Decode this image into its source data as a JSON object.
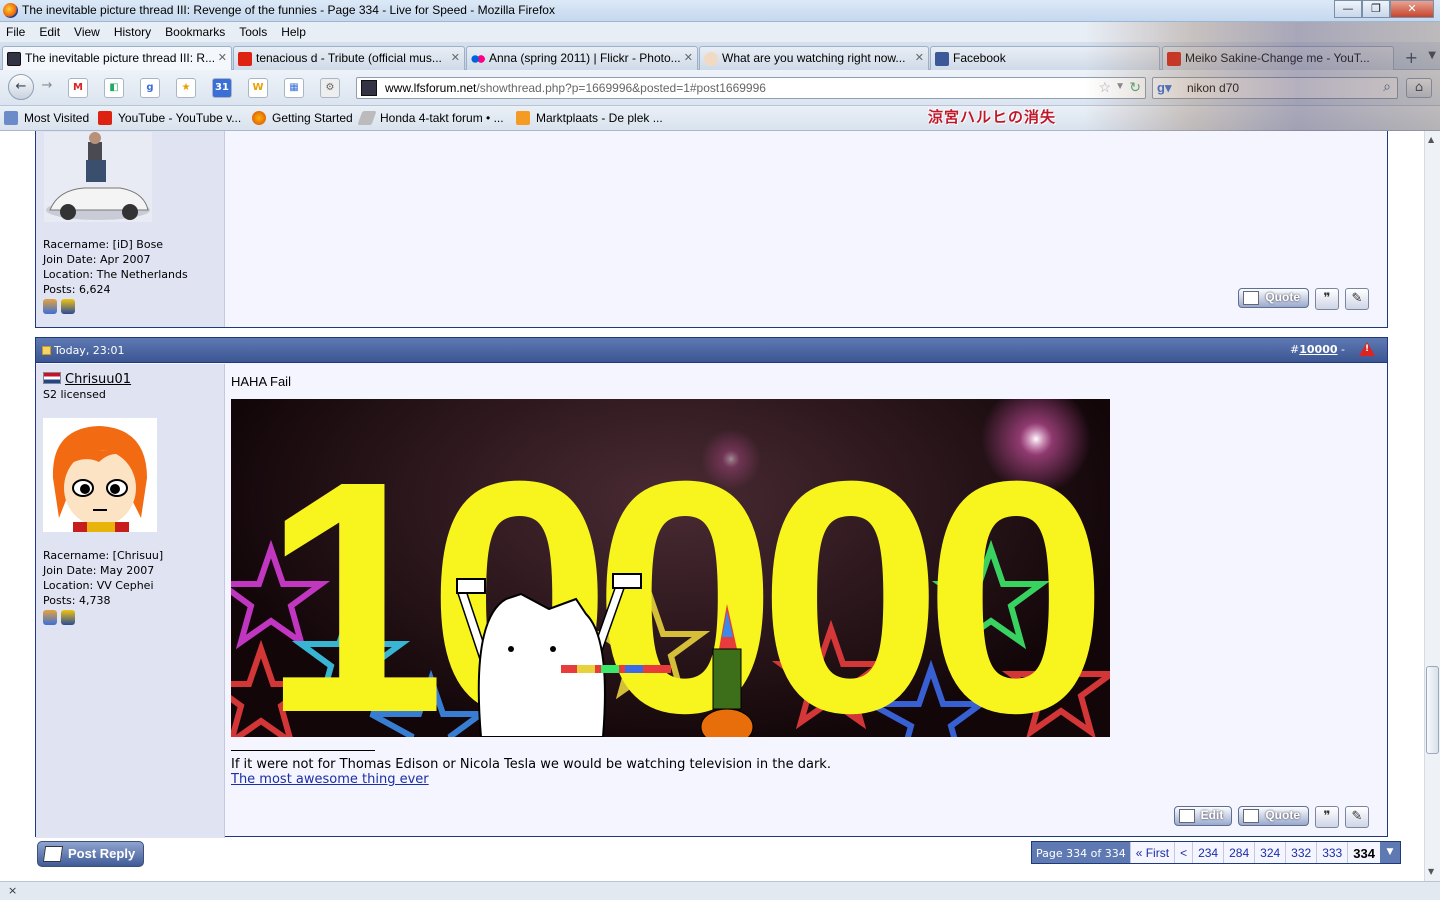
{
  "window": {
    "title": "The inevitable picture thread III: Revenge of the funnies - Page 334 - Live for Speed - Mozilla Firefox",
    "minimize": "—",
    "maximize": "❐",
    "close": "✕"
  },
  "menu": [
    "File",
    "Edit",
    "View",
    "History",
    "Bookmarks",
    "Tools",
    "Help"
  ],
  "tabs": [
    {
      "label": "The inevitable picture thread III: R...",
      "active": true
    },
    {
      "label": "tenacious d - Tribute (official mus...",
      "active": false
    },
    {
      "label": "Anna (spring 2011) | Flickr - Photo...",
      "active": false
    },
    {
      "label": "What are you watching right now...",
      "active": false
    },
    {
      "label": "Facebook",
      "active": false
    },
    {
      "label": "Meiko Sakine-Change me - YouT...",
      "active": false
    }
  ],
  "nav": {
    "url_domain": "www.lfsforum.net",
    "url_rest": "/showthread.php?p=1669996&posted=1#post1669996",
    "search_value": "nikon d70"
  },
  "bookmarks": [
    "Most Visited",
    "YouTube - YouTube v...",
    "Getting Started",
    "Honda 4-takt forum • ...",
    "Marktplaats - De plek ..."
  ],
  "persona_text": "涼宮ハルヒの消失",
  "post1": {
    "racername": "Racername: [iD] Bose",
    "join_date": "Join Date: Apr 2007",
    "location": "Location: The Netherlands",
    "posts": "Posts: 6,624",
    "quote_label": "Quote"
  },
  "post2": {
    "date": "Today, 23:01",
    "number_prefix": "#",
    "number": "10000",
    "number_suffix": "-",
    "username": "Chrisuu01",
    "user_title": "S2 licensed",
    "racername": "Racername: [Chrisuu]",
    "join_date": "Join Date: May 2007",
    "location": "Location: VV Cephei",
    "posts": "Posts: 4,738",
    "message": "HAHA Fail",
    "image_text": "10000",
    "signature": "If it were not for Thomas Edison or Nicola Tesla we would be watching television in the dark.",
    "signature_link": "The most awesome thing ever",
    "edit_label": "Edit",
    "quote_label": "Quote"
  },
  "post_reply": "Post Reply",
  "pagenav": {
    "label": "Page 334 of 334",
    "first": "« First",
    "prev": "<",
    "pages": [
      "234",
      "284",
      "324",
      "332",
      "333"
    ],
    "current": "334",
    "dropdown": "▼"
  },
  "status": {
    "close": "×"
  }
}
